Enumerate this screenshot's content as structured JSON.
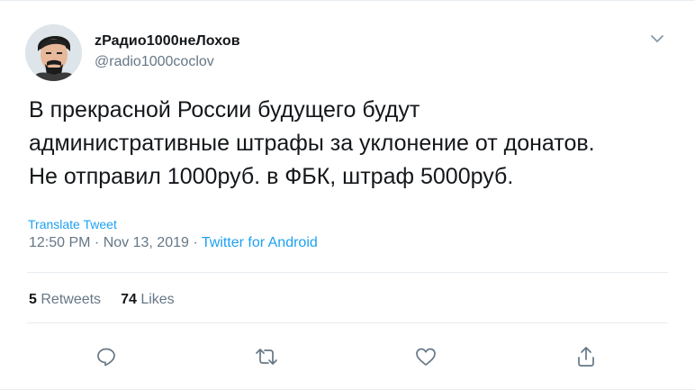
{
  "user": {
    "display_name": "zРадио1000неЛохов",
    "handle": "@radio1000coclov"
  },
  "tweet": {
    "lines": [
      "В прекрасной России будущего будут",
      "административные штрафы за уклонение от донатов.",
      "Не отправил 1000руб. в ФБК, штраф 5000руб."
    ],
    "translate_label": "Translate Tweet",
    "time": "12:50 PM",
    "separator": " · ",
    "date": "Nov 13, 2019",
    "source": "Twitter for Android"
  },
  "stats": {
    "retweets_count": "5",
    "retweets_label": "Retweets",
    "likes_count": "74",
    "likes_label": "Likes"
  },
  "actions": {
    "reply_icon": "reply-icon",
    "retweet_icon": "retweet-icon",
    "like_icon": "heart-icon",
    "share_icon": "share-icon",
    "menu_icon": "chevron-down-icon"
  },
  "colors": {
    "text": "#14171a",
    "secondary": "#657786",
    "link": "#1da1f2",
    "border": "#e6ecf0"
  }
}
